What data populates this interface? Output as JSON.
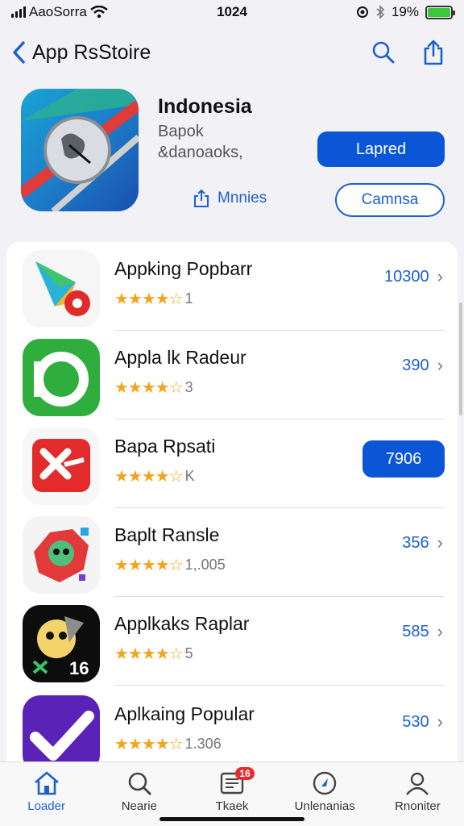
{
  "status": {
    "carrier": "AaoSorra",
    "time": "1024",
    "battery": "19%"
  },
  "nav": {
    "back_label": "App RsStoire"
  },
  "hero": {
    "title": "Indonesia",
    "subtitle1": "Bapok",
    "subtitle2": "&danoaoks,",
    "primary_button": "Lapred",
    "mini_link": "Mnnies",
    "outline_button": "Camnsa"
  },
  "apps": [
    {
      "name": "Appking Popbarr",
      "rating_count": "1",
      "price": "10300",
      "stars": "★★★★☆"
    },
    {
      "name": "Appla lk Radeur",
      "rating_count": "3",
      "price": "390",
      "stars": "★★★★☆"
    },
    {
      "name": "Bapa Rpsati",
      "rating_count": "K",
      "price": "7906",
      "stars": "★★★★☆"
    },
    {
      "name": "Baplt Ransle",
      "rating_count": "1,.005",
      "price": "356",
      "stars": "★★★★☆"
    },
    {
      "name": "Applkaks Raplar",
      "rating_count": "5",
      "price": "585",
      "stars": "★★★★☆"
    },
    {
      "name": "Aplkaing Popular",
      "rating_count": "1.306",
      "price": "530",
      "stars": "★★★★☆"
    }
  ],
  "tabs": [
    {
      "label": "Loader",
      "icon": "home-icon"
    },
    {
      "label": "Nearie",
      "icon": "search-icon"
    },
    {
      "label": "Tkaek",
      "icon": "news-icon",
      "badge": "16"
    },
    {
      "label": "Unlenanias",
      "icon": "compass-icon"
    },
    {
      "label": "Rnoniter",
      "icon": "person-icon"
    }
  ],
  "colors": {
    "accent": "#0a56d6",
    "star": "#f2a51c",
    "battery": "#3cc73c",
    "badge": "#e52d2d"
  }
}
